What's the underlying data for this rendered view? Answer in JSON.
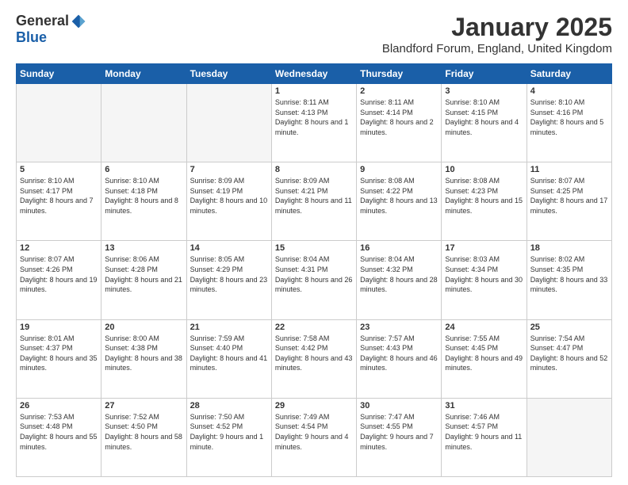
{
  "logo": {
    "general": "General",
    "blue": "Blue"
  },
  "title": "January 2025",
  "location": "Blandford Forum, England, United Kingdom",
  "days_of_week": [
    "Sunday",
    "Monday",
    "Tuesday",
    "Wednesday",
    "Thursday",
    "Friday",
    "Saturday"
  ],
  "weeks": [
    [
      {
        "day": "",
        "info": ""
      },
      {
        "day": "",
        "info": ""
      },
      {
        "day": "",
        "info": ""
      },
      {
        "day": "1",
        "info": "Sunrise: 8:11 AM\nSunset: 4:13 PM\nDaylight: 8 hours and 1 minute."
      },
      {
        "day": "2",
        "info": "Sunrise: 8:11 AM\nSunset: 4:14 PM\nDaylight: 8 hours and 2 minutes."
      },
      {
        "day": "3",
        "info": "Sunrise: 8:10 AM\nSunset: 4:15 PM\nDaylight: 8 hours and 4 minutes."
      },
      {
        "day": "4",
        "info": "Sunrise: 8:10 AM\nSunset: 4:16 PM\nDaylight: 8 hours and 5 minutes."
      }
    ],
    [
      {
        "day": "5",
        "info": "Sunrise: 8:10 AM\nSunset: 4:17 PM\nDaylight: 8 hours and 7 minutes."
      },
      {
        "day": "6",
        "info": "Sunrise: 8:10 AM\nSunset: 4:18 PM\nDaylight: 8 hours and 8 minutes."
      },
      {
        "day": "7",
        "info": "Sunrise: 8:09 AM\nSunset: 4:19 PM\nDaylight: 8 hours and 10 minutes."
      },
      {
        "day": "8",
        "info": "Sunrise: 8:09 AM\nSunset: 4:21 PM\nDaylight: 8 hours and 11 minutes."
      },
      {
        "day": "9",
        "info": "Sunrise: 8:08 AM\nSunset: 4:22 PM\nDaylight: 8 hours and 13 minutes."
      },
      {
        "day": "10",
        "info": "Sunrise: 8:08 AM\nSunset: 4:23 PM\nDaylight: 8 hours and 15 minutes."
      },
      {
        "day": "11",
        "info": "Sunrise: 8:07 AM\nSunset: 4:25 PM\nDaylight: 8 hours and 17 minutes."
      }
    ],
    [
      {
        "day": "12",
        "info": "Sunrise: 8:07 AM\nSunset: 4:26 PM\nDaylight: 8 hours and 19 minutes."
      },
      {
        "day": "13",
        "info": "Sunrise: 8:06 AM\nSunset: 4:28 PM\nDaylight: 8 hours and 21 minutes."
      },
      {
        "day": "14",
        "info": "Sunrise: 8:05 AM\nSunset: 4:29 PM\nDaylight: 8 hours and 23 minutes."
      },
      {
        "day": "15",
        "info": "Sunrise: 8:04 AM\nSunset: 4:31 PM\nDaylight: 8 hours and 26 minutes."
      },
      {
        "day": "16",
        "info": "Sunrise: 8:04 AM\nSunset: 4:32 PM\nDaylight: 8 hours and 28 minutes."
      },
      {
        "day": "17",
        "info": "Sunrise: 8:03 AM\nSunset: 4:34 PM\nDaylight: 8 hours and 30 minutes."
      },
      {
        "day": "18",
        "info": "Sunrise: 8:02 AM\nSunset: 4:35 PM\nDaylight: 8 hours and 33 minutes."
      }
    ],
    [
      {
        "day": "19",
        "info": "Sunrise: 8:01 AM\nSunset: 4:37 PM\nDaylight: 8 hours and 35 minutes."
      },
      {
        "day": "20",
        "info": "Sunrise: 8:00 AM\nSunset: 4:38 PM\nDaylight: 8 hours and 38 minutes."
      },
      {
        "day": "21",
        "info": "Sunrise: 7:59 AM\nSunset: 4:40 PM\nDaylight: 8 hours and 41 minutes."
      },
      {
        "day": "22",
        "info": "Sunrise: 7:58 AM\nSunset: 4:42 PM\nDaylight: 8 hours and 43 minutes."
      },
      {
        "day": "23",
        "info": "Sunrise: 7:57 AM\nSunset: 4:43 PM\nDaylight: 8 hours and 46 minutes."
      },
      {
        "day": "24",
        "info": "Sunrise: 7:55 AM\nSunset: 4:45 PM\nDaylight: 8 hours and 49 minutes."
      },
      {
        "day": "25",
        "info": "Sunrise: 7:54 AM\nSunset: 4:47 PM\nDaylight: 8 hours and 52 minutes."
      }
    ],
    [
      {
        "day": "26",
        "info": "Sunrise: 7:53 AM\nSunset: 4:48 PM\nDaylight: 8 hours and 55 minutes."
      },
      {
        "day": "27",
        "info": "Sunrise: 7:52 AM\nSunset: 4:50 PM\nDaylight: 8 hours and 58 minutes."
      },
      {
        "day": "28",
        "info": "Sunrise: 7:50 AM\nSunset: 4:52 PM\nDaylight: 9 hours and 1 minute."
      },
      {
        "day": "29",
        "info": "Sunrise: 7:49 AM\nSunset: 4:54 PM\nDaylight: 9 hours and 4 minutes."
      },
      {
        "day": "30",
        "info": "Sunrise: 7:47 AM\nSunset: 4:55 PM\nDaylight: 9 hours and 7 minutes."
      },
      {
        "day": "31",
        "info": "Sunrise: 7:46 AM\nSunset: 4:57 PM\nDaylight: 9 hours and 11 minutes."
      },
      {
        "day": "",
        "info": ""
      }
    ]
  ]
}
